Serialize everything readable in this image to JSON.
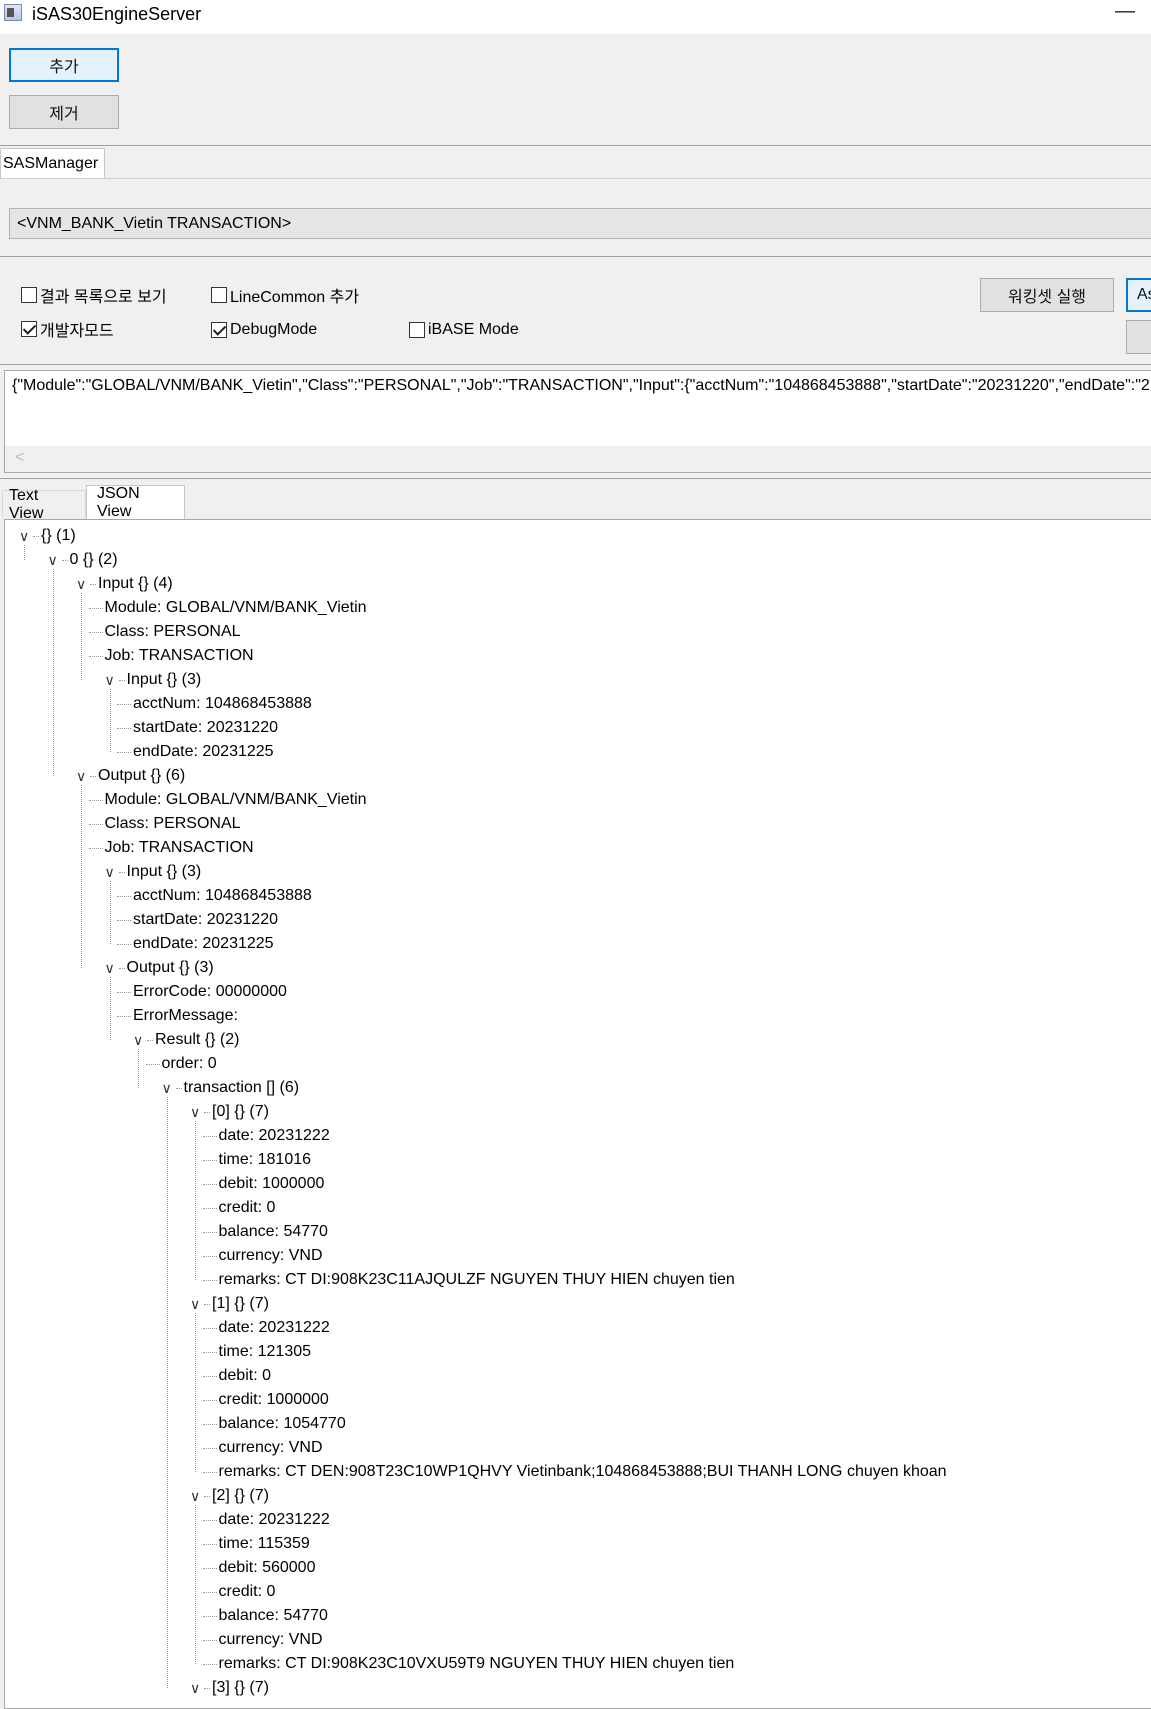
{
  "window": {
    "title": "iSAS30EngineServer",
    "minimize_glyph": "—"
  },
  "toolbar": {
    "add_label": "추가",
    "remove_label": "제거"
  },
  "manager_tab": {
    "label": "SASManager"
  },
  "selector": {
    "value": "<VNM_BANK_Vietin TRANSACTION>"
  },
  "options": {
    "result_list": {
      "label": "결과 목록으로 보기",
      "checked": false
    },
    "line_common": {
      "label": "LineCommon 추가",
      "checked": false
    },
    "dev_mode": {
      "label": "개발자모드",
      "checked": true
    },
    "debug_mode": {
      "label": "DebugMode",
      "checked": true
    },
    "ibase_mode": {
      "label": "iBASE Mode",
      "checked": false
    },
    "run_workingset_label": "워킹셋 실행",
    "partial_button_label": "As"
  },
  "json_input": {
    "value": "{\"Module\":\"GLOBAL/VNM/BANK_Vietin\",\"Class\":\"PERSONAL\",\"Job\":\"TRANSACTION\",\"Input\":{\"acctNum\":\"104868453888\",\"startDate\":\"20231220\",\"endDate\":\"2",
    "scroll_left_glyph": "<"
  },
  "view_tabs": [
    {
      "label": "Text View",
      "active": false
    },
    {
      "label": "JSON View",
      "active": true
    }
  ],
  "icons": {
    "expand": "chevron-down-icon",
    "scroll_left": "arrow-left-icon",
    "app": "app-window-icon"
  },
  "tree": [
    {
      "t": "{} (1)",
      "d": 0,
      "exp": true
    },
    {
      "t": "0 {} (2)",
      "d": 1,
      "exp": true
    },
    {
      "t": "Input {} (4)",
      "d": 2,
      "exp": true
    },
    {
      "t": "Module: GLOBAL/VNM/BANK_Vietin",
      "d": 3
    },
    {
      "t": "Class: PERSONAL",
      "d": 3
    },
    {
      "t": "Job: TRANSACTION",
      "d": 3
    },
    {
      "t": "Input {} (3)",
      "d": 3,
      "exp": true
    },
    {
      "t": "acctNum: 104868453888",
      "d": 4
    },
    {
      "t": "startDate: 20231220",
      "d": 4
    },
    {
      "t": "endDate: 20231225",
      "d": 4
    },
    {
      "t": "Output {} (6)",
      "d": 2,
      "exp": true
    },
    {
      "t": "Module: GLOBAL/VNM/BANK_Vietin",
      "d": 3
    },
    {
      "t": "Class: PERSONAL",
      "d": 3
    },
    {
      "t": "Job: TRANSACTION",
      "d": 3
    },
    {
      "t": "Input {} (3)",
      "d": 3,
      "exp": true
    },
    {
      "t": "acctNum: 104868453888",
      "d": 4
    },
    {
      "t": "startDate: 20231220",
      "d": 4
    },
    {
      "t": "endDate: 20231225",
      "d": 4
    },
    {
      "t": "Output {} (3)",
      "d": 3,
      "exp": true
    },
    {
      "t": "ErrorCode: 00000000",
      "d": 4
    },
    {
      "t": "ErrorMessage:",
      "d": 4
    },
    {
      "t": "Result {} (2)",
      "d": 4,
      "exp": true
    },
    {
      "t": "order: 0",
      "d": 5
    },
    {
      "t": "transaction [] (6)",
      "d": 5,
      "exp": true
    },
    {
      "t": "[0] {} (7)",
      "d": 6,
      "exp": true
    },
    {
      "t": "date: 20231222",
      "d": 7
    },
    {
      "t": "time: 181016",
      "d": 7
    },
    {
      "t": "debit: 1000000",
      "d": 7
    },
    {
      "t": "credit: 0",
      "d": 7
    },
    {
      "t": "balance: 54770",
      "d": 7
    },
    {
      "t": "currency: VND",
      "d": 7
    },
    {
      "t": "remarks: CT DI:908K23C11AJQULZF NGUYEN THUY HIEN chuyen tien",
      "d": 7
    },
    {
      "t": "[1] {} (7)",
      "d": 6,
      "exp": true
    },
    {
      "t": "date: 20231222",
      "d": 7
    },
    {
      "t": "time: 121305",
      "d": 7
    },
    {
      "t": "debit: 0",
      "d": 7
    },
    {
      "t": "credit: 1000000",
      "d": 7
    },
    {
      "t": "balance: 1054770",
      "d": 7
    },
    {
      "t": "currency: VND",
      "d": 7
    },
    {
      "t": "remarks: CT DEN:908T23C10WP1QHVY Vietinbank;104868453888;BUI THANH LONG chuyen khoan",
      "d": 7
    },
    {
      "t": "[2] {} (7)",
      "d": 6,
      "exp": true
    },
    {
      "t": "date: 20231222",
      "d": 7
    },
    {
      "t": "time: 115359",
      "d": 7
    },
    {
      "t": "debit: 560000",
      "d": 7
    },
    {
      "t": "credit: 0",
      "d": 7
    },
    {
      "t": "balance: 54770",
      "d": 7
    },
    {
      "t": "currency: VND",
      "d": 7
    },
    {
      "t": "remarks: CT DI:908K23C10VXU59T9 NGUYEN THUY HIEN chuyen tien",
      "d": 7
    },
    {
      "t": "[3] {} (7)",
      "d": 6,
      "exp": true
    }
  ]
}
